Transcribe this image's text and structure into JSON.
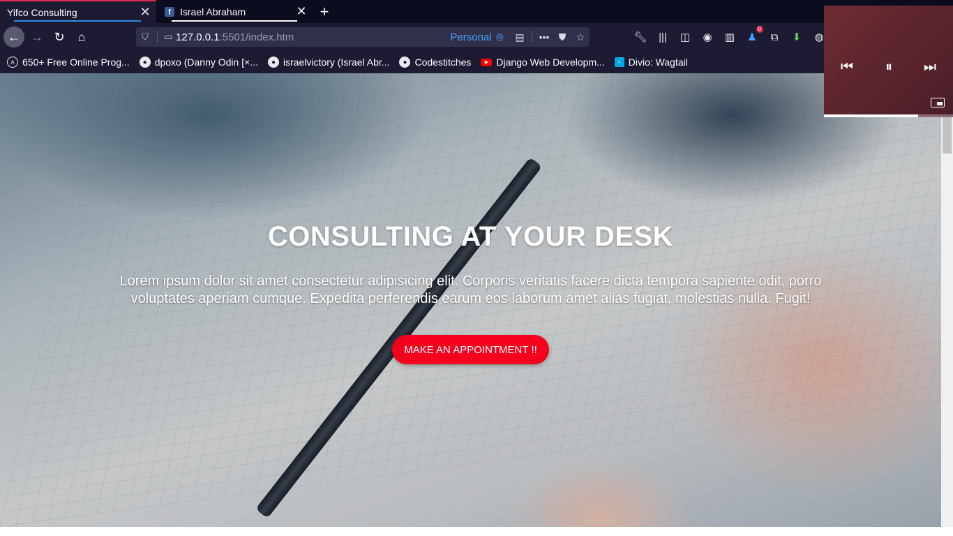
{
  "tabs": [
    {
      "title": "Yifco Consulting",
      "active": true,
      "underline": "#2b8ae2"
    },
    {
      "title": "Israel Abraham",
      "active": false,
      "underline": "#ffffff"
    }
  ],
  "navbar": {
    "url_host": "127.0.0.1",
    "url_path": ":5501/index.htm",
    "container_label": "Personal"
  },
  "toolbar": {
    "notification_count": "0"
  },
  "bookmarks": [
    {
      "label": "650+ Free Online Prog...",
      "icon": "angular-icon"
    },
    {
      "label": "dpoxo (Danny Odin [×...",
      "icon": "github-icon"
    },
    {
      "label": "israelvictory (Israel Abr...",
      "icon": "github-icon"
    },
    {
      "label": "Codestitches",
      "icon": "github-icon"
    },
    {
      "label": "Django Web Developm...",
      "icon": "youtube-icon"
    },
    {
      "label": "Divio: Wagtail",
      "icon": "divio-icon"
    }
  ],
  "hero": {
    "title": "CONSULTING AT YOUR DESK",
    "text": "Lorem ipsum dolor sit amet consectetur adipisicing elit. Corporis veritatis facere dicta tempora sapiente odit, porro voluptates aperiam cumque. Expedita perferendis earum eos laborum amet alias fugiat, molestias nulla. Fugit!",
    "cta_label": "MAKE AN APPOINTMENT !!",
    "cta_color": "#f5001d"
  },
  "media": {
    "progress": 0.73
  }
}
